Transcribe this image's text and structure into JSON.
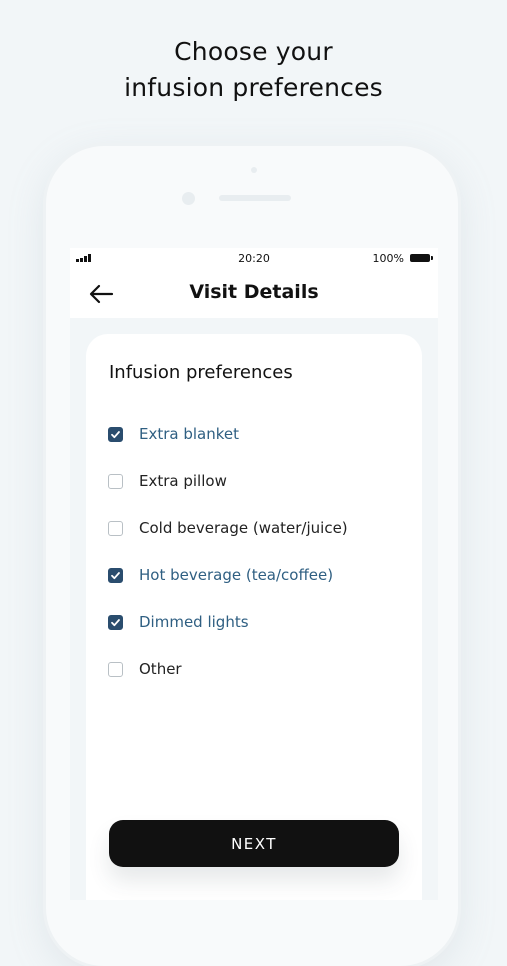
{
  "headline": {
    "line1": "Choose your",
    "line2": "infusion preferences"
  },
  "status_bar": {
    "time": "20:20",
    "battery": "100%"
  },
  "nav": {
    "back_icon": "arrow-left-icon",
    "title": "Visit Details"
  },
  "card": {
    "title": "Infusion preferences",
    "options": [
      {
        "label": "Extra blanket",
        "checked": true
      },
      {
        "label": "Extra pillow",
        "checked": false
      },
      {
        "label": "Cold beverage (water/juice)",
        "checked": false
      },
      {
        "label": "Hot beverage (tea/coffee)",
        "checked": true
      },
      {
        "label": "Dimmed lights",
        "checked": true
      },
      {
        "label": "Other",
        "checked": false
      }
    ]
  },
  "actions": {
    "next_label": "NEXT"
  },
  "colors": {
    "accent": "#2a4d6e",
    "checked_text": "#2f5f82",
    "button": "#111111",
    "background": "#f2f6f8"
  }
}
